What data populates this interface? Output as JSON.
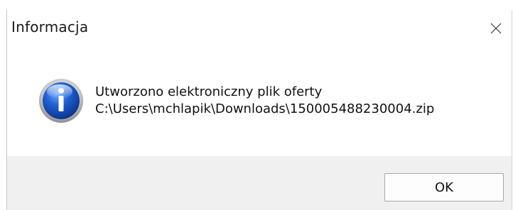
{
  "window": {
    "title": "Informacja",
    "close_icon": "close-icon"
  },
  "message": {
    "line1": "Utworzono elektroniczny plik oferty",
    "line2": "C:\\Users\\mchlapik\\Downloads\\150005488230004.zip",
    "icon": "info-icon"
  },
  "buttons": {
    "ok_label": "OK"
  },
  "colors": {
    "footer_background": "#f0f0f0",
    "icon_blue": "#1e5bb8"
  }
}
